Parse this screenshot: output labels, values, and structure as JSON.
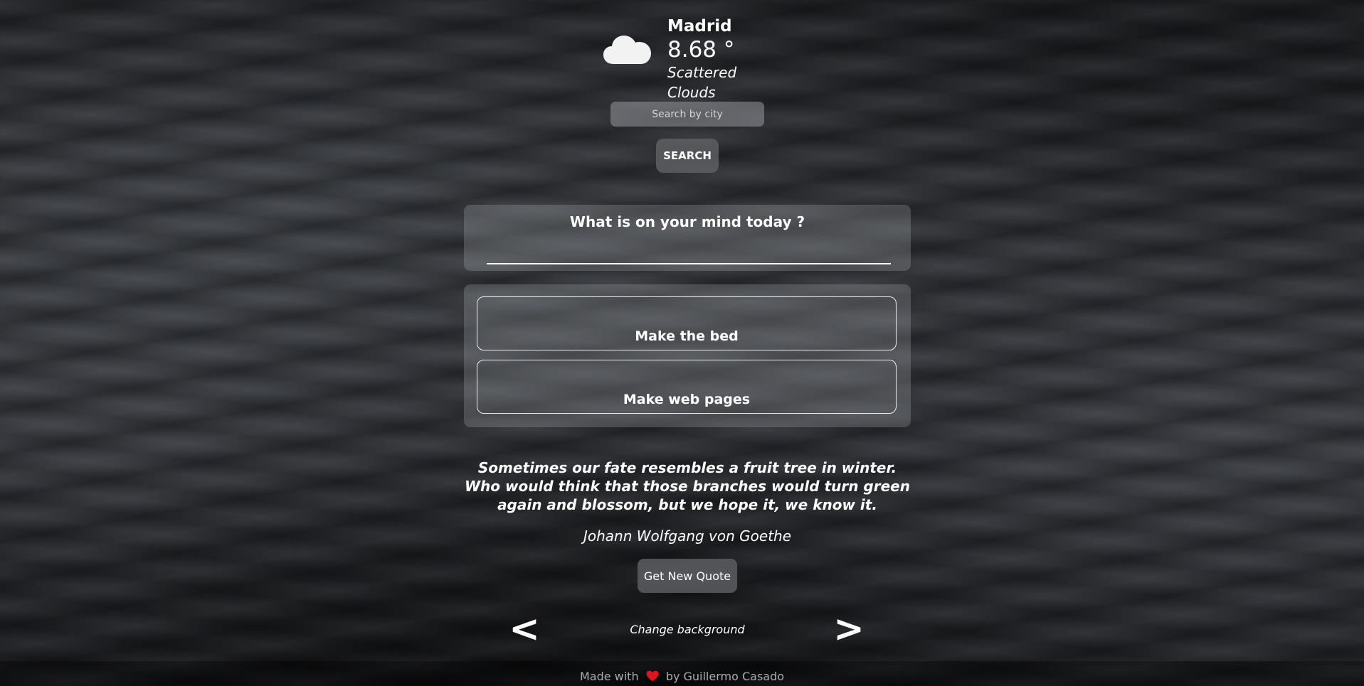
{
  "weather": {
    "icon": "cloud-icon",
    "city": "Madrid",
    "temperature": "8.68 °",
    "description": "Scattered Clouds"
  },
  "search": {
    "placeholder": "Search by city",
    "button_label": "SEARCH"
  },
  "mind": {
    "title": "What is on your mind today ?",
    "value": ""
  },
  "todos": [
    {
      "label": "Make the bed"
    },
    {
      "label": "Make web pages"
    }
  ],
  "quote": {
    "text": "Sometimes our fate resembles a fruit tree in winter. Who would think that those branches would turn green again and blossom, but we hope it, we know it.",
    "author": "Johann Wolfgang von Goethe",
    "button_label": "Get New Quote"
  },
  "background_nav": {
    "prev_label": "<",
    "next_label": ">",
    "label": "Change background"
  },
  "footer": {
    "made_with": "Made with",
    "by": "by",
    "author": "Guillermo Casado",
    "heart_color": "#e0141e"
  },
  "colors": {
    "panel": "rgba(170,172,176,0.28)",
    "text": "#ffffff"
  }
}
